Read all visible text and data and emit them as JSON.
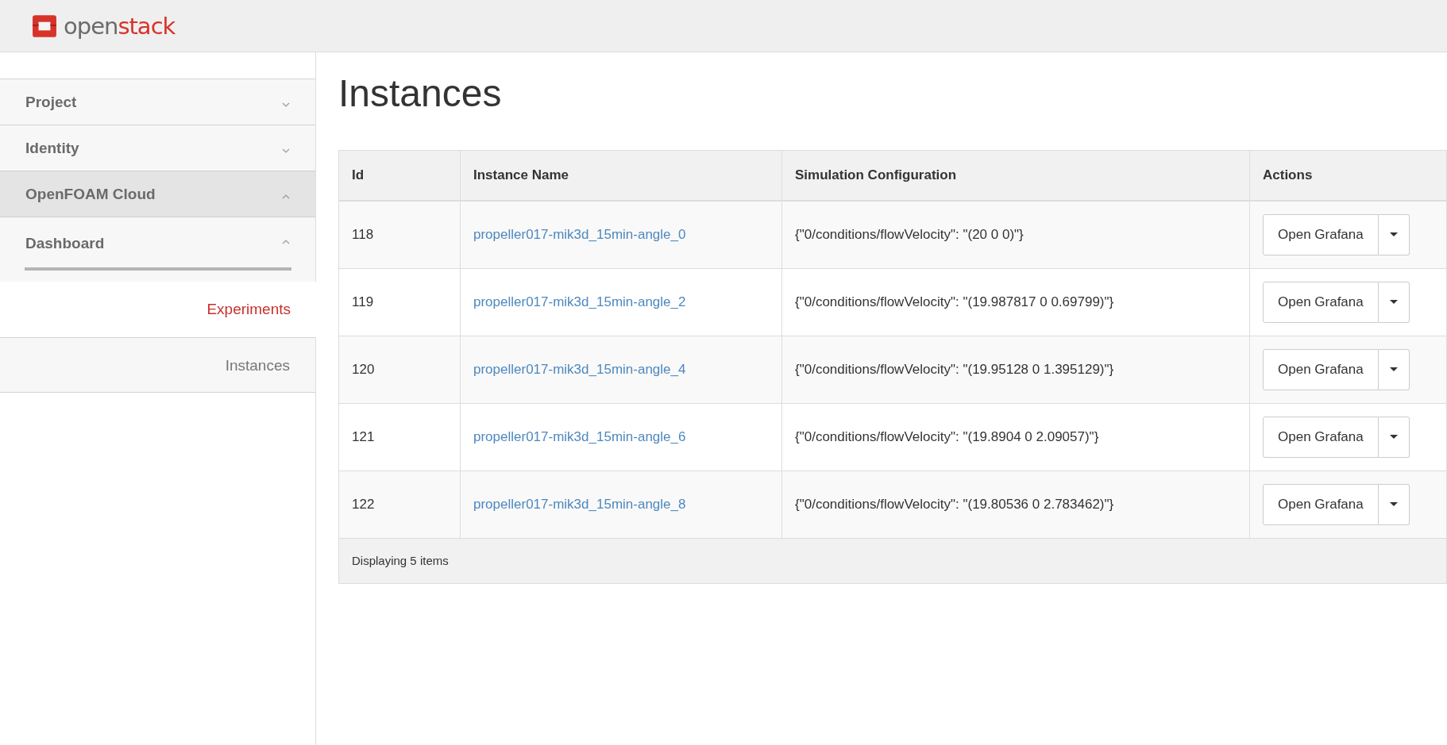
{
  "header": {
    "logo_parts": [
      "open",
      "stack"
    ]
  },
  "sidebar": {
    "items": [
      {
        "label": "Project",
        "expanded": false
      },
      {
        "label": "Identity",
        "expanded": false
      },
      {
        "label": "OpenFOAM Cloud",
        "expanded": true,
        "children": [
          {
            "label": "Dashboard",
            "expanded": true,
            "children": [
              {
                "label": "Experiments",
                "selected": true
              },
              {
                "label": "Instances",
                "selected": false
              }
            ]
          }
        ]
      }
    ]
  },
  "page_title": "Instances",
  "table": {
    "columns": [
      "Id",
      "Instance Name",
      "Simulation Configuration",
      "Actions"
    ],
    "rows": [
      {
        "id": "118",
        "name": "propeller017-mik3d_15min-angle_0",
        "config": "{\"0/conditions/flowVelocity\": \"(20 0 0)\"}",
        "action": "Open Grafana"
      },
      {
        "id": "119",
        "name": "propeller017-mik3d_15min-angle_2",
        "config": "{\"0/conditions/flowVelocity\": \"(19.987817 0 0.69799)\"}",
        "action": "Open Grafana"
      },
      {
        "id": "120",
        "name": "propeller017-mik3d_15min-angle_4",
        "config": "{\"0/conditions/flowVelocity\": \"(19.95128 0 1.395129)\"}",
        "action": "Open Grafana"
      },
      {
        "id": "121",
        "name": "propeller017-mik3d_15min-angle_6",
        "config": "{\"0/conditions/flowVelocity\": \"(19.8904 0 2.09057)\"}",
        "action": "Open Grafana"
      },
      {
        "id": "122",
        "name": "propeller017-mik3d_15min-angle_8",
        "config": "{\"0/conditions/flowVelocity\": \"(19.80536 0 2.783462)\"}",
        "action": "Open Grafana"
      }
    ],
    "footer": "Displaying 5 items"
  }
}
